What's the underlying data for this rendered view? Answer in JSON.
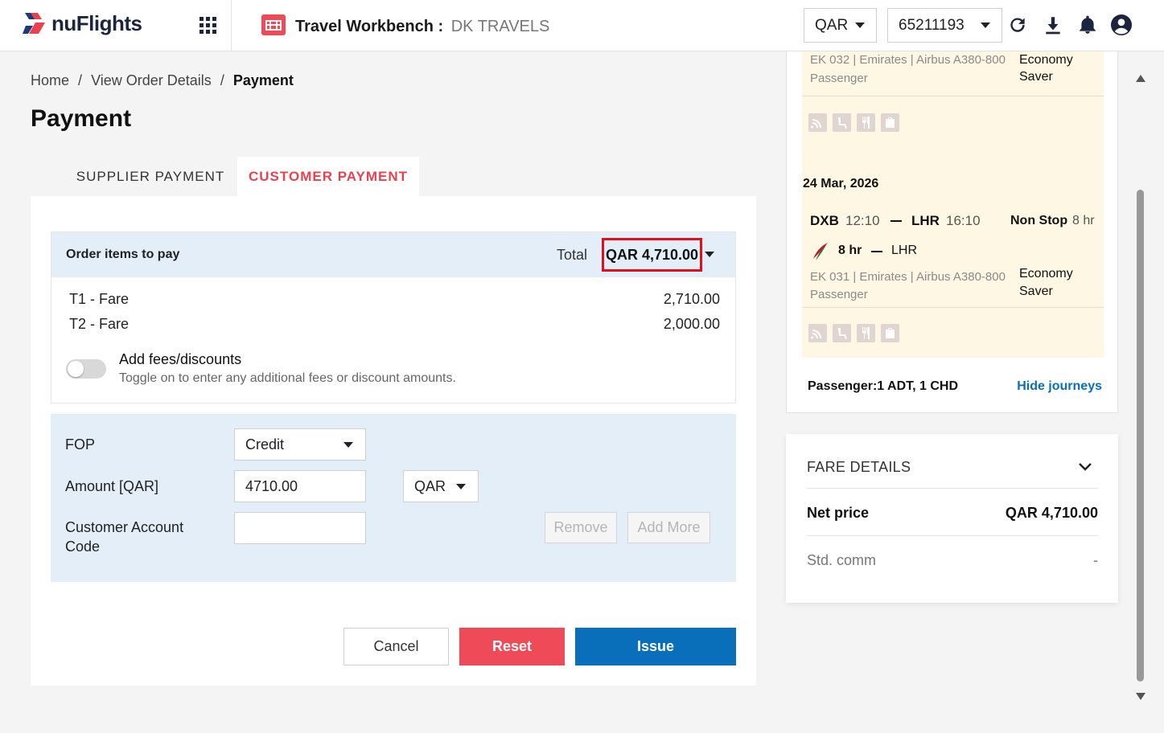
{
  "header": {
    "logo_text": "nuFlights",
    "workbench_title": "Travel Workbench",
    "separator": ":",
    "agency": "DK TRAVELS",
    "currency_select": "QAR",
    "account_select": "65211193",
    "icons": [
      "apps-grid-icon",
      "travel-workbench-icon",
      "refresh-icon",
      "download-icon",
      "bell-icon",
      "user-account-icon"
    ]
  },
  "breadcrumb": {
    "items": [
      "Home",
      "View Order Details",
      "Payment"
    ],
    "separator": "/"
  },
  "page_title": "Payment",
  "tabs": [
    {
      "label": "SUPPLIER PAYMENT",
      "active": false
    },
    {
      "label": "CUSTOMER PAYMENT",
      "active": true
    }
  ],
  "order": {
    "label": "Order items to pay",
    "total_label": "Total",
    "total_value": "QAR 4,710.00",
    "items": [
      {
        "label": "T1  - Fare",
        "amount": "2,710.00"
      },
      {
        "label": "T2  - Fare",
        "amount": "2,000.00"
      }
    ],
    "fees_title": "Add fees/discounts",
    "fees_subtitle": "Toggle on to enter any additional fees or discount amounts.",
    "fees_toggle_on": false
  },
  "fop": {
    "fop_label": "FOP",
    "fop_value": "Credit",
    "amount_label": "Amount [QAR]",
    "amount_value": "4710.00",
    "amount_currency": "QAR",
    "account_label": "Customer Account Code",
    "account_value": "",
    "remove_label": "Remove",
    "add_more_label": "Add More"
  },
  "actions": {
    "cancel": "Cancel",
    "reset": "Reset",
    "issue": "Issue"
  },
  "journey": {
    "segment_top": {
      "flight_line": "EK 032 | Emirates | Airbus A380-800",
      "pax_type": "Passenger",
      "cabin_line1": "Economy",
      "cabin_line2": "Saver"
    },
    "date": "24 Mar, 2026",
    "segment_bottom": {
      "from": "DXB",
      "dep_time": "12:10",
      "to": "LHR",
      "arr_time": "16:10",
      "stops": "Non Stop",
      "duration": "8 hr",
      "leg_duration": "8 hr",
      "leg_to": "LHR",
      "flight_line": "EK 031 | Emirates | Airbus A380-800",
      "pax_type": "Passenger",
      "cabin_line1": "Economy",
      "cabin_line2": "Saver"
    },
    "amenities": [
      "wifi-icon",
      "seat-icon",
      "meal-icon",
      "baggage-icon"
    ],
    "passenger_summary": "Passenger:1 ADT, 1 CHD",
    "hide_link": "Hide journeys"
  },
  "fare_details": {
    "title": "FARE DETAILS",
    "net_price_label": "Net price",
    "net_price_value": "QAR 4,710.00",
    "std_comm_label": "Std. comm",
    "std_comm_value": "-"
  },
  "colors": {
    "brand_red": "#e8424f",
    "reset_red": "#ef4a57",
    "issue_blue": "#0a6fba",
    "highlight_border": "#e0101a",
    "light_blue_bg": "#e3eef8",
    "segment_bg": "#fdf7e3"
  }
}
